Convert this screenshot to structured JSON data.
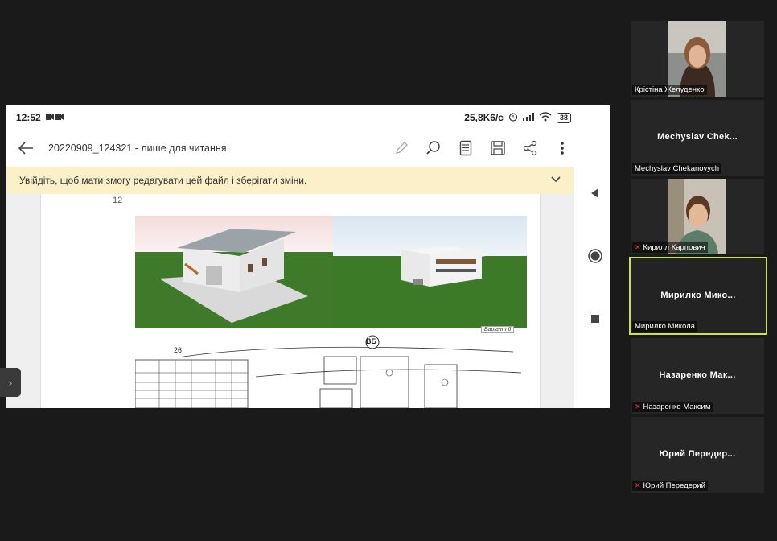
{
  "phone": {
    "time": "12:52",
    "speed": "25,8K6/c",
    "battery": "38"
  },
  "toolbar": {
    "title": "20220909_124321 - лише для читання"
  },
  "banner": {
    "text": "Увійдіть, щоб мати змогу редагувати цей файл і зберігати зміни."
  },
  "document": {
    "page_number": "12",
    "stamp_text": "Варіант 6",
    "plan_label_1": "26",
    "plan_label_2": "ВБ"
  },
  "participants": [
    {
      "name": "Крістіна Желуденко",
      "center": "",
      "muted": false,
      "video": true
    },
    {
      "name": "Mechyslav Chekanovych",
      "center": "Mechyslav  Chek...",
      "muted": false,
      "video": false
    },
    {
      "name": "Кирилл Карпович",
      "center": "",
      "muted": true,
      "video": true
    },
    {
      "name": "Мирилко Микола",
      "center": "Мирилко  Мико...",
      "muted": false,
      "video": false,
      "active": true
    },
    {
      "name": "Назаренко Максим",
      "center": "Назаренко  Мак...",
      "muted": true,
      "video": false
    },
    {
      "name": "Юрий Передерий",
      "center": "Юрий  Передер...",
      "muted": true,
      "video": false
    }
  ],
  "colors": {
    "active_border": "#c8e05a",
    "banner_bg": "#fbf0c8",
    "mic_off": "#e04040"
  }
}
